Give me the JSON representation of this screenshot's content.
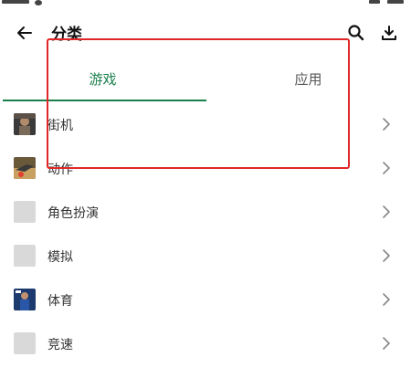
{
  "header": {
    "title": "分类",
    "back_icon": "back-arrow-icon",
    "search_icon": "search-icon",
    "download_icon": "download-icon"
  },
  "tabs": [
    {
      "label": "游戏",
      "active": true
    },
    {
      "label": "应用",
      "active": false
    }
  ],
  "categories": [
    {
      "label": "街机",
      "thumb": "arcade-thumbnail"
    },
    {
      "label": "动作",
      "thumb": "action-thumbnail"
    },
    {
      "label": "角色扮演",
      "thumb": "placeholder"
    },
    {
      "label": "模拟",
      "thumb": "placeholder"
    },
    {
      "label": "体育",
      "thumb": "sports-thumbnail"
    },
    {
      "label": "竞速",
      "thumb": "placeholder"
    }
  ],
  "colors": {
    "accent": "#1a7f4b",
    "highlight": "#e02626",
    "placeholder": "#d9d9d9"
  }
}
